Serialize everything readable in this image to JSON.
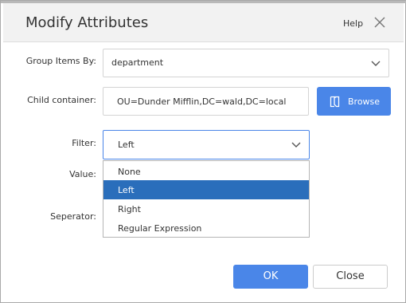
{
  "dialog": {
    "title": "Modify Attributes",
    "help_label": "Help"
  },
  "form": {
    "group_items_by": {
      "label": "Group Items By:",
      "value": "department"
    },
    "child_container": {
      "label": "Child container:",
      "value": "OU=Dunder Mifflin,DC=wald,DC=local",
      "browse_label": "Browse"
    },
    "filter": {
      "label": "Filter:",
      "value": "Left",
      "options": [
        "None",
        "Left",
        "Right",
        "Regular Expression"
      ],
      "selected_index": 1
    },
    "value": {
      "label": "Value:"
    },
    "separator": {
      "label": "Seperator:"
    }
  },
  "footer": {
    "ok_label": "OK",
    "close_label": "Close"
  },
  "colors": {
    "accent": "#4a86e8",
    "selected_option": "#2a6ebb",
    "header_bg": "#f2f2f2"
  }
}
